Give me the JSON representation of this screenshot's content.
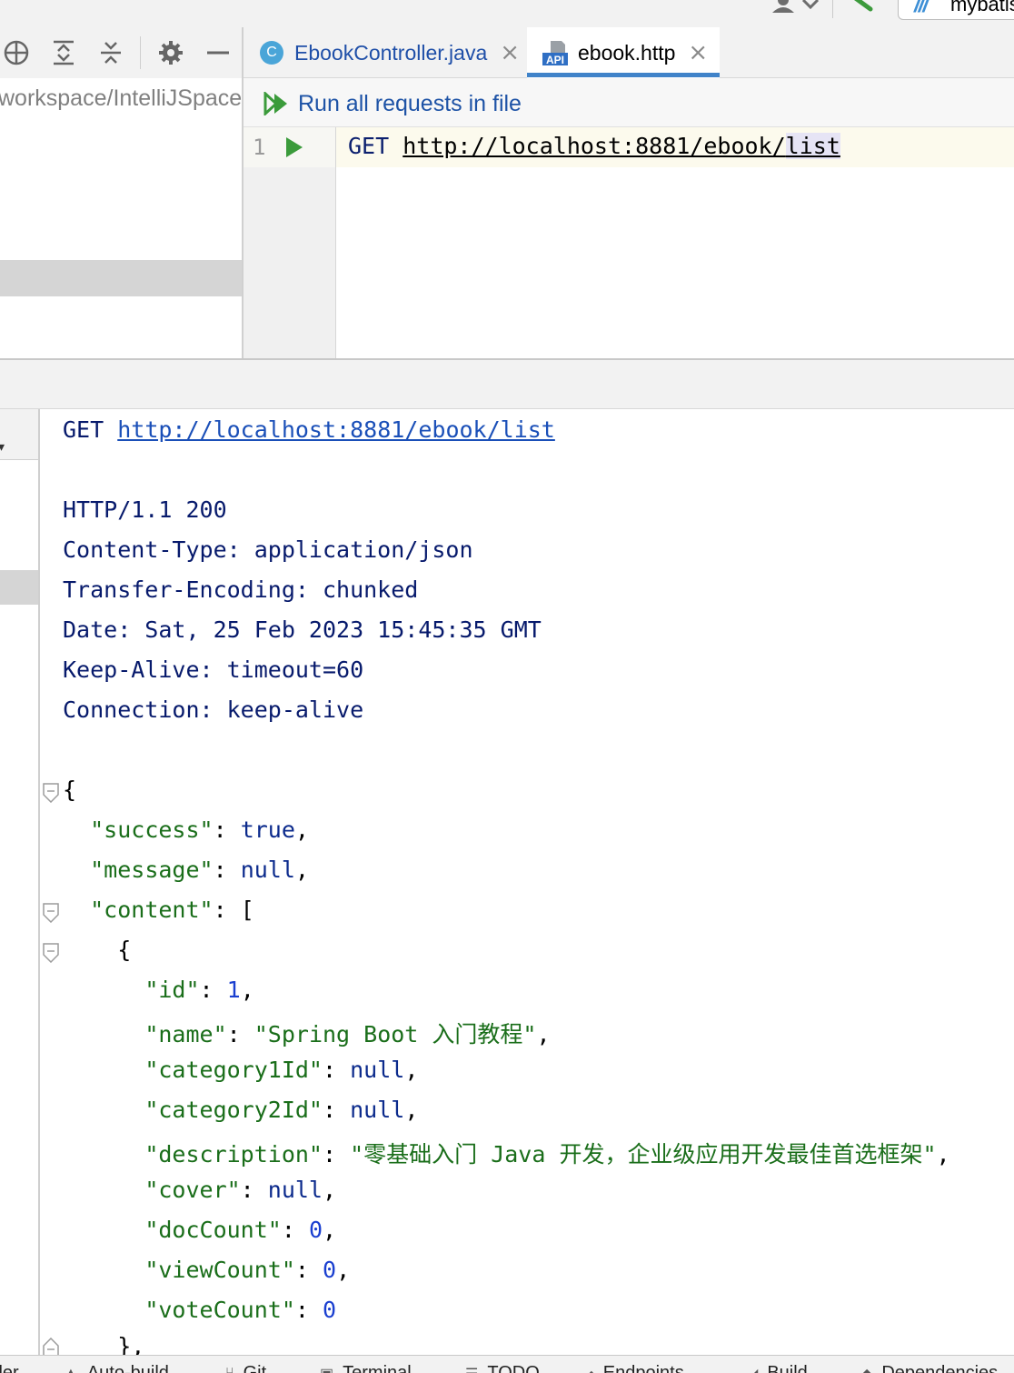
{
  "toolbar": {
    "run_config_label": "mybatis"
  },
  "project": {
    "path": "workspace/IntelliJSpace"
  },
  "tabs": [
    {
      "label": "EbookController.java",
      "icon": "class-icon",
      "icon_text": "C"
    },
    {
      "label": "ebook.http",
      "icon": "api-file-icon",
      "icon_text": "API",
      "active": true
    }
  ],
  "editor": {
    "run_all_label": "Run all requests in file",
    "line_number": "1",
    "method": "GET",
    "url_prefix": "http://localhost:8881/ebook/",
    "url_highlight": "list"
  },
  "response": {
    "request_method": "GET",
    "request_url": "http://localhost:8881/ebook/list",
    "status_line": "HTTP/1.1 200",
    "headers": [
      "Content-Type: application/json",
      "Transfer-Encoding: chunked",
      "Date: Sat, 25 Feb 2023 15:45:35 GMT",
      "Keep-Alive: timeout=60",
      "Connection: keep-alive"
    ],
    "json": {
      "open_brace": "{",
      "success_key": "\"success\"",
      "success_val": "true",
      "message_key": "\"message\"",
      "message_val": "null",
      "content_key": "\"content\"",
      "content_open": "[",
      "item_open": "{",
      "id_key": "\"id\"",
      "id_val": "1",
      "name_key": "\"name\"",
      "name_val": "\"Spring Boot 入门教程\"",
      "cat1_key": "\"category1Id\"",
      "cat1_val": "null",
      "cat2_key": "\"category2Id\"",
      "cat2_val": "null",
      "desc_key": "\"description\"",
      "desc_val": "\"零基础入门 Java 开发，企业级应用开发最佳首选框架\"",
      "cover_key": "\"cover\"",
      "cover_val": "null",
      "doc_key": "\"docCount\"",
      "doc_val": "0",
      "view_key": "\"viewCount\"",
      "view_val": "0",
      "vote_key": "\"voteCount\"",
      "vote_val": "0",
      "item_close": "},"
    }
  },
  "bottom_tabs": [
    {
      "label": "ller",
      "icon": "tool-icon"
    },
    {
      "label": "Auto-build",
      "icon": "auto-build-icon"
    },
    {
      "label": "Git",
      "icon": "git-icon"
    },
    {
      "label": "Terminal",
      "icon": "terminal-icon"
    },
    {
      "label": "TODO",
      "icon": "todo-icon"
    },
    {
      "label": "Endpoints",
      "icon": "endpoints-icon"
    },
    {
      "label": "Build",
      "icon": "build-icon"
    },
    {
      "label": "Dependencies",
      "icon": "dependencies-icon"
    }
  ]
}
